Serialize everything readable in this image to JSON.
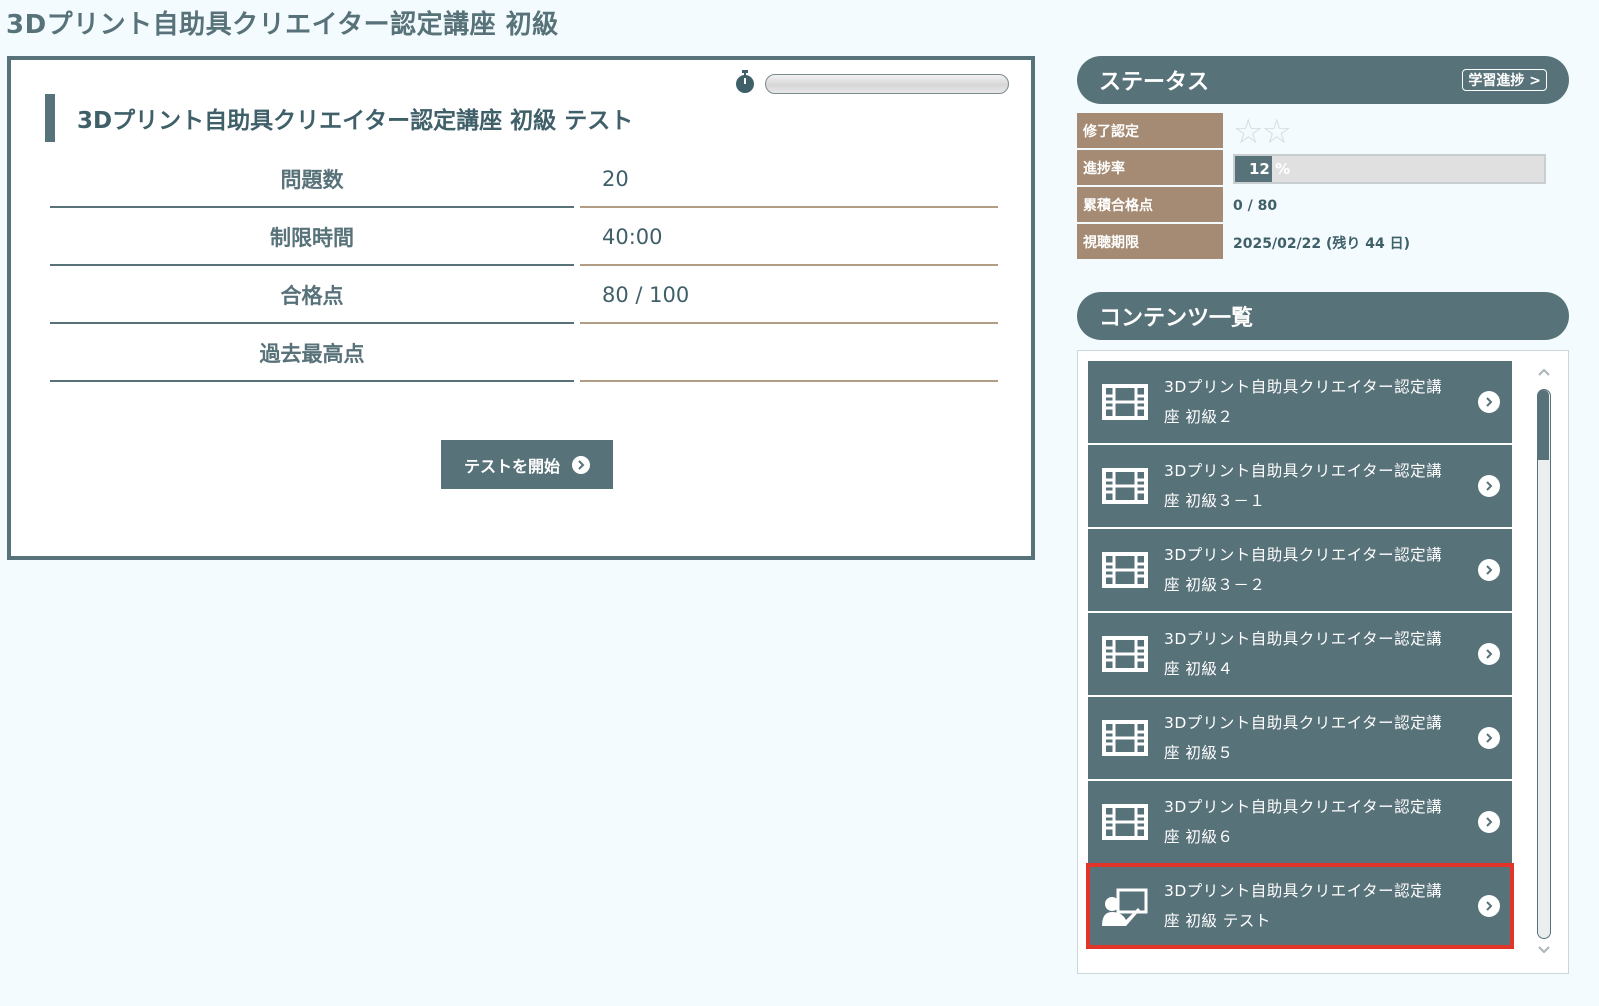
{
  "page": {
    "title": "3Dプリント自助具クリエイター認定講座 初級"
  },
  "test": {
    "title": "3Dプリント自助具クリエイター認定講座 初級 テスト",
    "rows": [
      {
        "label": "問題数",
        "value": "20"
      },
      {
        "label": "制限時間",
        "value": "40:00"
      },
      {
        "label": "合格点",
        "value": "80 / 100"
      },
      {
        "label": "過去最高点",
        "value": ""
      }
    ],
    "start_button": "テストを開始"
  },
  "status": {
    "header": "ステータス",
    "link": "学習進捗 >",
    "completion_label": "修了認定",
    "completion_stars": 0,
    "progress_label": "進捗率",
    "progress_value": 12,
    "progress_text": "12 %",
    "score_label": "累積合格点",
    "score_value": "0 / 80",
    "period_label": "視聴期限",
    "period_value": "2025/02/22 (残り 44 日)"
  },
  "contents": {
    "header": "コンテンツ一覧",
    "items": [
      {
        "line1": "3Dプリント自助具クリエイター認定講",
        "line2": "座 初級２",
        "icon": "film-icon"
      },
      {
        "line1": "3Dプリント自助具クリエイター認定講",
        "line2": "座 初級３－１",
        "icon": "film-icon"
      },
      {
        "line1": "3Dプリント自助具クリエイター認定講",
        "line2": "座 初級３－２",
        "icon": "film-icon"
      },
      {
        "line1": "3Dプリント自助具クリエイター認定講",
        "line2": "座 初級４",
        "icon": "film-icon"
      },
      {
        "line1": "3Dプリント自助具クリエイター認定講",
        "line2": "座 初級５",
        "icon": "film-icon"
      },
      {
        "line1": "3Dプリント自助具クリエイター認定講",
        "line2": "座 初級６",
        "icon": "film-icon"
      },
      {
        "line1": "3Dプリント自助具クリエイター認定講",
        "line2": "座 初級 テスト",
        "icon": "teacher-board-icon"
      }
    ]
  },
  "colors": {
    "primary": "#587279",
    "label_brown": "#a58b73",
    "highlight": "#e2352a",
    "background": "#f3fbfe"
  }
}
